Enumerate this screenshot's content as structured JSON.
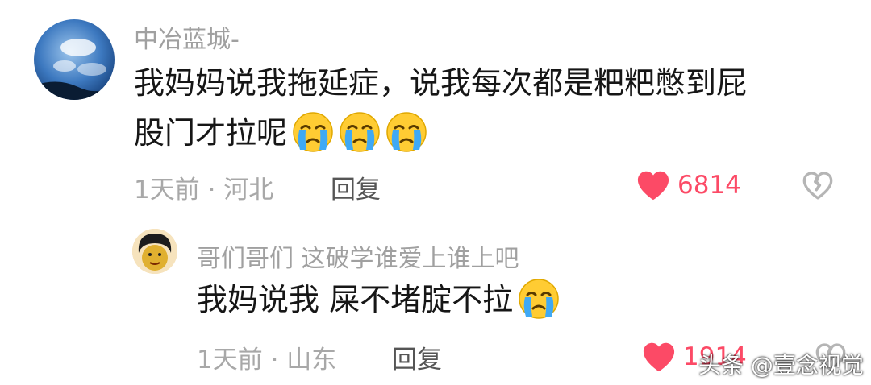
{
  "comment": {
    "username": "中冶蓝城-",
    "text_line1": "我妈妈说我拖延症，说我每次都是粑粑憋到屁",
    "text_line2": "股门才拉呢",
    "time_location": "1天前 · 河北",
    "reply_label": "回复",
    "likes": "6814",
    "emojis": [
      "crying-face",
      "crying-face",
      "crying-face"
    ]
  },
  "reply": {
    "username": "哥们哥们 这破学谁爱上谁上吧",
    "text": "我妈说我 屎不堵腚不拉",
    "time_location": "1天前 · 山东",
    "reply_label": "回复",
    "likes": "1914",
    "emojis": [
      "crying-face"
    ]
  },
  "watermark": "头条 @壹念视觉",
  "colors": {
    "like_heart": "#fc4a66",
    "meta_gray": "#a8a8a8",
    "text_dark": "#161616"
  }
}
